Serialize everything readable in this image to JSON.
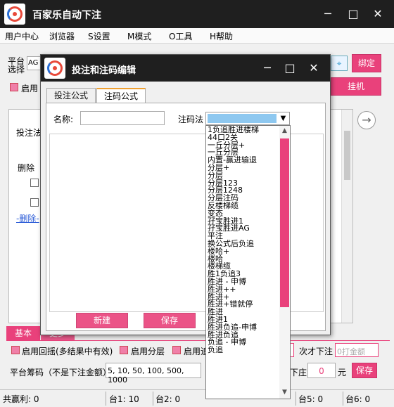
{
  "window": {
    "title": "百家乐自动下注",
    "minimize": "─",
    "maximize": "□",
    "close": "✕"
  },
  "menu": [
    "用户中心",
    "浏览器",
    "S设置",
    "M模式",
    "O工具",
    "H帮助"
  ],
  "top_panel": {
    "platform_label_1": "平台",
    "platform_label_2": "选择",
    "platform_value": "AG",
    "bind_button": "绑定",
    "enable_label": "启用",
    "hang_button": "挂机"
  },
  "main_panel": {
    "bet_label": "投注法",
    "delete_label": "删除",
    "delete_link": "-删除-"
  },
  "bottom_tabs": [
    "基本",
    "更多"
  ],
  "options": {
    "recheck": "启用回摇(多结果中有效)",
    "layer": "启用分层",
    "enable_cut": "启用追",
    "next_bet": "次才下注",
    "hit_amount": "0打金额",
    "platform_chips_label": "平台筹码（不是下注金额）",
    "platform_chips_value": "5, 10, 50, 100, 500, 1000",
    "stop_label": "下庄",
    "stop_value": "0",
    "unit": "元",
    "save": "保存"
  },
  "status": {
    "total_profit": "共赢利: 0",
    "table1": "台1: 10",
    "table2": "台2: 0",
    "table5": "台5: 0",
    "table6": "台6: 0"
  },
  "dialog": {
    "title": "投注和注码编辑",
    "tabs": [
      "投注公式",
      "注码公式"
    ],
    "name_label": "名称:",
    "name_value": "",
    "method_label": "注码法",
    "new_button": "新建",
    "save_button": "保存",
    "options": [
      "1负追胜进楼梯",
      "44口2关",
      "一丘分层+",
      "一丘分层",
      "内置-赢进输退",
      "分层+",
      "分层",
      "分层123",
      "分层1248",
      "分层注码",
      "反楼梯缆",
      "变态",
      "孖宝胜进1",
      "孖宝胜进AG",
      "平注",
      "换公式后负追",
      "楼哈+",
      "楼哈",
      "楼梯缆",
      "胜1负追3",
      "胜进 - 申博",
      "胜进++",
      "胜进+",
      "胜进+错就停",
      "胜进",
      "胜进1",
      "胜进负追-申博",
      "胜进负追",
      "负追 - 申博",
      "负追"
    ]
  }
}
